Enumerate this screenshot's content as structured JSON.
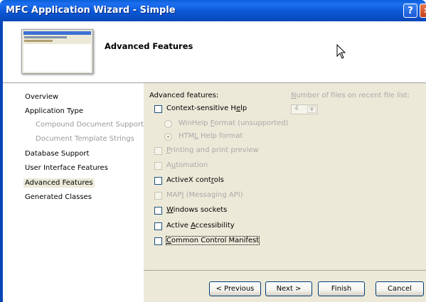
{
  "window": {
    "title": "MFC Application Wizard - Simple",
    "help_glyph": "?",
    "close_glyph": "✕"
  },
  "header": {
    "title": "Advanced Features"
  },
  "nav": {
    "items": [
      {
        "label": "Overview",
        "state": "normal"
      },
      {
        "label": "Application Type",
        "state": "normal"
      },
      {
        "label": "Compound Document Support",
        "state": "sub"
      },
      {
        "label": "Document Template Strings",
        "state": "sub"
      },
      {
        "label": "Database Support",
        "state": "normal"
      },
      {
        "label": "User Interface Features",
        "state": "normal"
      },
      {
        "label": "Advanced Features",
        "state": "selected"
      },
      {
        "label": "Generated Classes",
        "state": "normal"
      }
    ]
  },
  "features": {
    "group_label": "Advanced features:",
    "context_help": {
      "pre": "Context-sensitive H",
      "key": "e",
      "post": "lp",
      "checked": false
    },
    "winhelp": {
      "pre": "WinHelp ",
      "key": "F",
      "post": "ormat (unsupported)"
    },
    "htmlhelp": {
      "pre": "HTM",
      "key": "L",
      "post": " Help format"
    },
    "printing": {
      "pre": "",
      "key": "P",
      "post": "rinting and print preview"
    },
    "automation": {
      "pre": "A",
      "key": "u",
      "post": "tomation"
    },
    "activex": {
      "pre": "ActiveX cont",
      "key": "r",
      "post": "ols"
    },
    "mapi": {
      "pre": "MAP",
      "key": "I",
      "post": " (Messaging API)"
    },
    "sockets": {
      "pre": "",
      "key": "W",
      "post": "indows sockets"
    },
    "accessibility": {
      "pre": "Active ",
      "key": "A",
      "post": "ccessibility"
    },
    "manifest": {
      "pre": "",
      "key": "C",
      "post": "ommon Control Manifest"
    }
  },
  "recent_files": {
    "label_pre": "",
    "label_key": "N",
    "label_post": "umber of files on recent file list:",
    "value": "4",
    "arrow": "▼"
  },
  "buttons": {
    "previous": "< Previous",
    "next": "Next >",
    "finish": "Finish",
    "cancel": "Cancel"
  }
}
